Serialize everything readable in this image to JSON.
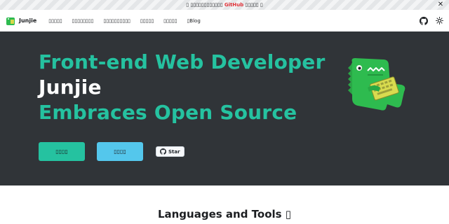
{
  "announcement": {
    "prefix": "▯ ▯▯▯▯▯▯▯▯▯▯▯▯ ",
    "link_text": "GitHub",
    "suffix": " ▯▯▯▯▯ ▯",
    "close_glyph": "✕"
  },
  "navbar": {
    "brand": "Junjie",
    "items": [
      {
        "label": "▯▯▯▯▯"
      },
      {
        "label": "▯▯▯▯▯▯▯▯"
      },
      {
        "label": "▯▯▯▯▯▯▯▯▯▯"
      },
      {
        "label": "▯▯▯▯▯"
      },
      {
        "label": "▯▯▯▯▯"
      },
      {
        "label": "▯Blog"
      }
    ]
  },
  "hero": {
    "line1": "Front-end Web Developer",
    "line2": "Junjie",
    "line3": "Embraces Open Source",
    "primary_button": "▯▯▯▯",
    "secondary_button": "▯▯▯▯",
    "star_label": "Star"
  },
  "section": {
    "title": "Languages and Tools ▯"
  },
  "colors": {
    "accent": "#25c2a0",
    "secondary": "#54c7ec",
    "hero_bg": "#303438",
    "link": "#e13238"
  }
}
